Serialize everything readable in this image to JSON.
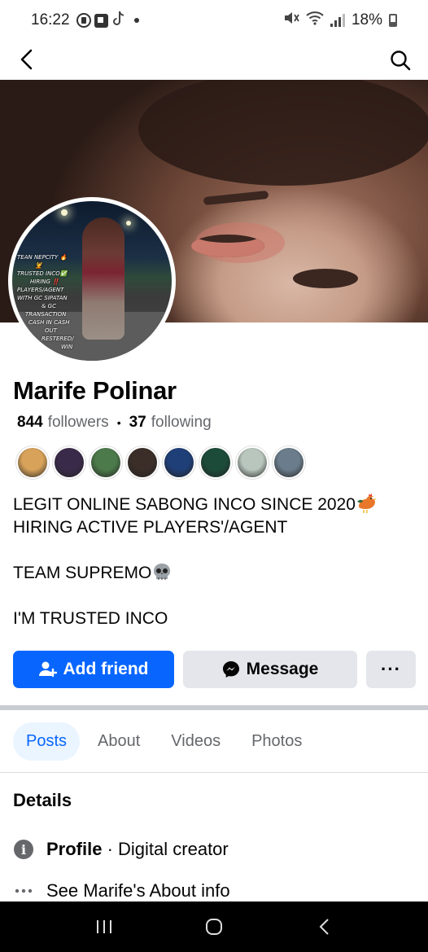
{
  "status_bar": {
    "time": "16:22",
    "battery": "18%"
  },
  "profile": {
    "name": "Marife Polinar",
    "followers_count": "844",
    "followers_label": "followers",
    "separator": "•",
    "following_count": "37",
    "following_label": "following",
    "avatar_text": [
      "TEAN NEPCITY 🔥",
      "💆",
      "TRUSTED INCO✅",
      "HIRING ‼️",
      "PLAYERS/AGENT",
      "WITH GC SIPATAN",
      "& GC",
      "TRANSACTION",
      "CASH IN CASH",
      "OUT",
      "RESTERED/",
      "WIN"
    ]
  },
  "mutual_friends": [
    {
      "color": "#d8a25a"
    },
    {
      "color": "#3a2a4a"
    },
    {
      "color": "#4c7a4a"
    },
    {
      "color": "#3b2e28"
    },
    {
      "color": "#1f3f78"
    },
    {
      "color": "#1c4b3a"
    },
    {
      "color": "#b9c6bd"
    },
    {
      "color": "#6b7d8c"
    }
  ],
  "bio": {
    "line1": "LEGIT ONLINE SABONG INCO SINCE 2020",
    "line2": "HIRING ACTIVE PLAYERS'/AGENT",
    "line3": "TEAM SUPREMO",
    "line4": "I'M TRUSTED INCO"
  },
  "actions": {
    "add_friend": "Add friend",
    "message": "Message",
    "more": "···"
  },
  "tabs": [
    {
      "label": "Posts",
      "active": true
    },
    {
      "label": "About",
      "active": false
    },
    {
      "label": "Videos",
      "active": false
    },
    {
      "label": "Photos",
      "active": false
    }
  ],
  "details": {
    "title": "Details",
    "profile_label": "Profile",
    "profile_sep": " · ",
    "profile_value": "Digital creator",
    "about_link": "See Marife's About info"
  },
  "colors": {
    "accent": "#0866ff",
    "button_gray": "#e4e6eb",
    "muted_text": "#65676b"
  },
  "icons": {
    "back": "chevron-left-icon",
    "search": "search-icon",
    "add_friend": "person-add-icon",
    "message": "messenger-icon",
    "info": "info-icon",
    "more": "ellipsis-icon"
  }
}
